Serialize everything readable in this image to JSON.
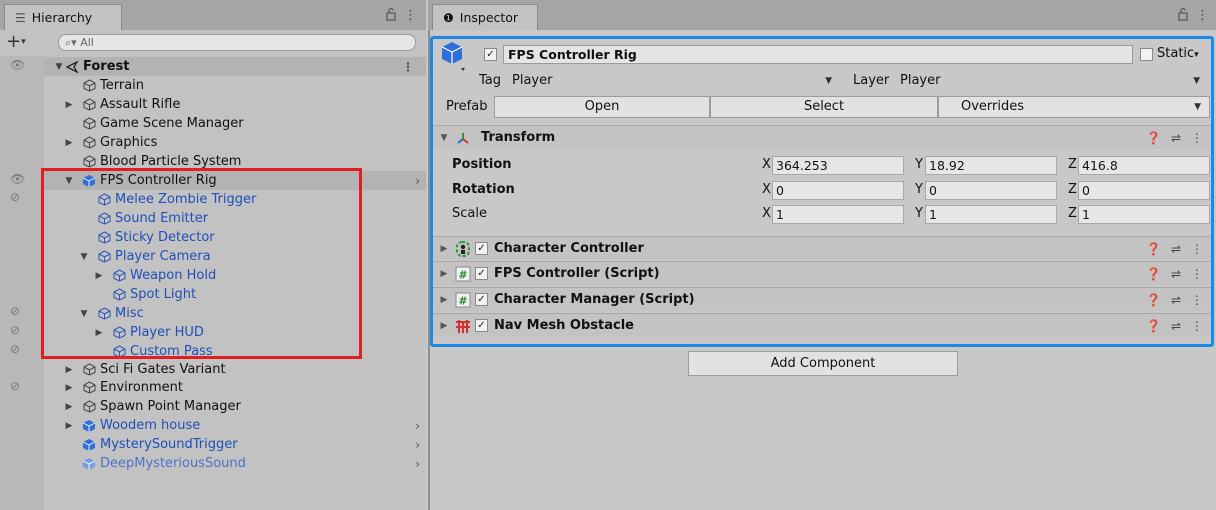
{
  "hierarchy": {
    "tab_label": "Hierarchy",
    "add_label": "+",
    "search_placeholder": "All",
    "scene_name": "Forest",
    "items": [
      {
        "label": "Terrain"
      },
      {
        "label": "Assault Rifle"
      },
      {
        "label": "Game Scene Manager"
      },
      {
        "label": "Graphics"
      },
      {
        "label": "Blood Particle System"
      },
      {
        "label": "FPS Controller Rig"
      },
      {
        "label": "Melee Zombie Trigger"
      },
      {
        "label": "Sound Emitter"
      },
      {
        "label": "Sticky Detector"
      },
      {
        "label": "Player Camera"
      },
      {
        "label": "Weapon Hold"
      },
      {
        "label": "Spot Light"
      },
      {
        "label": "Misc"
      },
      {
        "label": "Player HUD"
      },
      {
        "label": "Custom Pass"
      },
      {
        "label": "Sci Fi Gates Variant"
      },
      {
        "label": "Environment"
      },
      {
        "label": "Spawn Point Manager"
      },
      {
        "label": "Woodem house"
      },
      {
        "label": "MysterySoundTrigger"
      },
      {
        "label": "DeepMysteriousSound"
      }
    ]
  },
  "inspector": {
    "tab_label": "Inspector",
    "object_name": "FPS Controller Rig",
    "static_label": "Static",
    "tag_label": "Tag",
    "tag_value": "Player",
    "layer_label": "Layer",
    "layer_value": "Player",
    "prefab_label": "Prefab",
    "prefab_open": "Open",
    "prefab_select": "Select",
    "prefab_overrides": "Overrides",
    "transform": {
      "title": "Transform",
      "position_label": "Position",
      "rotation_label": "Rotation",
      "scale_label": "Scale",
      "axis_x": "X",
      "axis_y": "Y",
      "axis_z": "Z",
      "position": {
        "x": "364.253",
        "y": "18.92",
        "z": "416.8"
      },
      "rotation": {
        "x": "0",
        "y": "0",
        "z": "0"
      },
      "scale": {
        "x": "1",
        "y": "1",
        "z": "1"
      }
    },
    "components": [
      {
        "title": "Character Controller"
      },
      {
        "title": "FPS Controller (Script)"
      },
      {
        "title": "Character Manager (Script)"
      },
      {
        "title": "Nav Mesh Obstacle"
      }
    ],
    "add_component_label": "Add Component"
  },
  "colors": {
    "prefab_blue": "#1f4fb8",
    "selection_highlight": "#e02020",
    "inspector_highlight": "#1e88e5"
  }
}
